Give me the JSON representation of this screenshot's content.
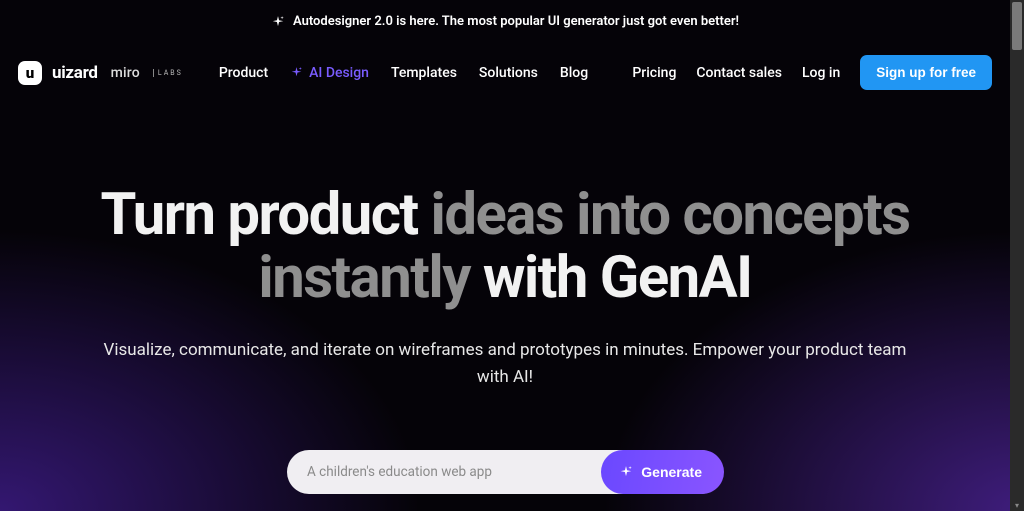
{
  "banner": {
    "text": "Autodesigner 2.0 is here. The most popular UI generator just got even better!"
  },
  "brand": {
    "logo_letter": "u",
    "name": "uizard",
    "partner": "miro",
    "partner_suffix": "LABS"
  },
  "nav": {
    "primary": {
      "product": "Product",
      "ai_design": "AI Design",
      "templates": "Templates",
      "solutions": "Solutions",
      "blog": "Blog"
    },
    "secondary": {
      "pricing": "Pricing",
      "contact": "Contact sales",
      "login": "Log in",
      "signup": "Sign up for free"
    }
  },
  "hero": {
    "headline_part1": "Turn product",
    "headline_part2": "ideas into concepts instantly",
    "headline_part3": "with GenAI",
    "subhead": "Visualize, communicate, and iterate on wireframes and prototypes in minutes. Empower your product team with AI!"
  },
  "prompt": {
    "placeholder": "A children's education web app",
    "button": "Generate"
  }
}
